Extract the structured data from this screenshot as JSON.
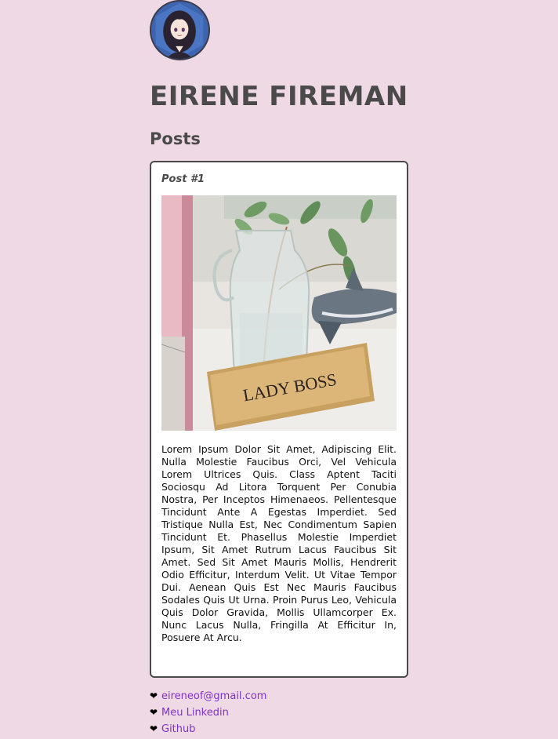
{
  "profile": {
    "name": "EIRENE FIREMAN",
    "avatar_alt": "avatar"
  },
  "posts_section": {
    "heading": "Posts"
  },
  "post": {
    "title": "Post #1",
    "image_sign_text": "LADY BOSS",
    "body": "Lorem Ipsum Dolor Sit Amet, Adipiscing Elit. Nulla Molestie Faucibus Orci, Vel Vehicula Lorem Ultrices Quis. Class Aptent Taciti Sociosqu Ad Litora Torquent Per Conubia Nostra, Per Inceptos Himenaeos. Pellentesque Tincidunt Ante A Egestas Imperdiet. Sed Tristique Nulla Est, Nec Condimentum Sapien Tincidunt Et. Phasellus Molestie Imperdiet Ipsum, Sit Amet Rutrum Lacus Faucibus Sit Amet. Sed Sit Amet Mauris Mollis, Hendrerit Odio Efficitur, Interdum Velit. Ut Vitae Tempor Dui. Aenean Quis Est Nec Mauris Faucibus Sodales Quis Ut Urna. Proin Purus Leo, Vehicula Quis Dolor Gravida, Mollis Ullamcorper Ex. Nunc Lacus Nulla, Fringilla At Efficitur In, Posuere At Arcu."
  },
  "contact_links": [
    {
      "icon": "heart-icon",
      "label": "eireneof@gmail.com"
    },
    {
      "icon": "heart-icon",
      "label": "Meu Linkedin"
    },
    {
      "icon": "heart-icon",
      "label": "Github"
    }
  ],
  "colors": {
    "background": "#efd9e4",
    "heading_text": "#4a4a4a",
    "link": "#8133c9",
    "card_border": "#4a4a4a"
  }
}
